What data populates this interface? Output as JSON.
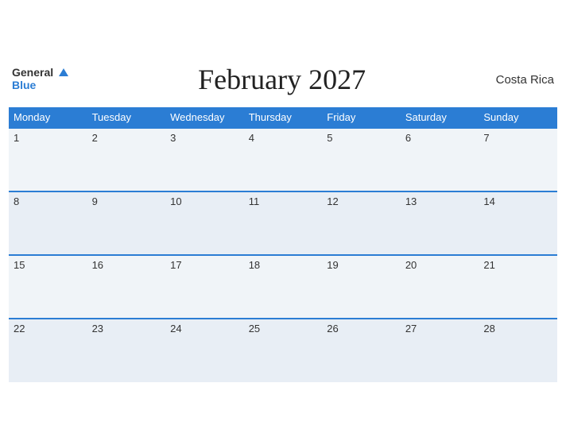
{
  "header": {
    "logo_top": "General",
    "logo_bottom": "Blue",
    "title": "February 2027",
    "country": "Costa Rica"
  },
  "weekdays": [
    "Monday",
    "Tuesday",
    "Wednesday",
    "Thursday",
    "Friday",
    "Saturday",
    "Sunday"
  ],
  "weeks": [
    [
      {
        "day": "1"
      },
      {
        "day": "2"
      },
      {
        "day": "3"
      },
      {
        "day": "4"
      },
      {
        "day": "5"
      },
      {
        "day": "6"
      },
      {
        "day": "7"
      }
    ],
    [
      {
        "day": "8"
      },
      {
        "day": "9"
      },
      {
        "day": "10"
      },
      {
        "day": "11"
      },
      {
        "day": "12"
      },
      {
        "day": "13"
      },
      {
        "day": "14"
      }
    ],
    [
      {
        "day": "15"
      },
      {
        "day": "16"
      },
      {
        "day": "17"
      },
      {
        "day": "18"
      },
      {
        "day": "19"
      },
      {
        "day": "20"
      },
      {
        "day": "21"
      }
    ],
    [
      {
        "day": "22"
      },
      {
        "day": "23"
      },
      {
        "day": "24"
      },
      {
        "day": "25"
      },
      {
        "day": "26"
      },
      {
        "day": "27"
      },
      {
        "day": "28"
      }
    ]
  ]
}
